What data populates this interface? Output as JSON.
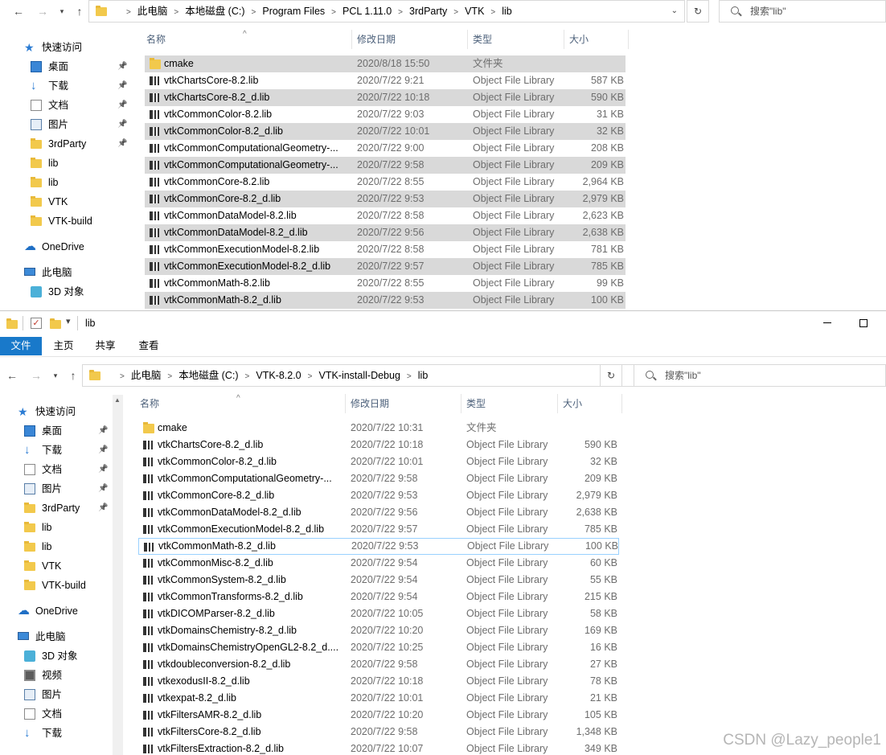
{
  "top_window": {
    "breadcrumbs": [
      "此电脑",
      "本地磁盘 (C:)",
      "Program Files",
      "PCL 1.11.0",
      "3rdParty",
      "VTK",
      "lib"
    ],
    "search_placeholder": "搜索\"lib\"",
    "columns": {
      "name": "名称",
      "date": "修改日期",
      "type": "类型",
      "size": "大小"
    },
    "nav": [
      {
        "label": "快速访问",
        "icon": "star-icon",
        "pinned": false,
        "indent": 1
      },
      {
        "label": "桌面",
        "icon": "desktop-icon",
        "pinned": true,
        "indent": 2
      },
      {
        "label": "下载",
        "icon": "download-icon",
        "pinned": true,
        "indent": 2
      },
      {
        "label": "文档",
        "icon": "document-icon",
        "pinned": true,
        "indent": 2
      },
      {
        "label": "图片",
        "icon": "pictures-icon",
        "pinned": true,
        "indent": 2
      },
      {
        "label": "3rdParty",
        "icon": "folder-icon",
        "pinned": true,
        "indent": 2
      },
      {
        "label": "lib",
        "icon": "folder-icon",
        "pinned": false,
        "indent": 2
      },
      {
        "label": "lib",
        "icon": "folder-icon",
        "pinned": false,
        "indent": 2
      },
      {
        "label": "VTK",
        "icon": "folder-icon",
        "pinned": false,
        "indent": 2
      },
      {
        "label": "VTK-build",
        "icon": "folder-icon",
        "pinned": false,
        "indent": 2
      },
      {
        "label": "OneDrive",
        "icon": "cloud-icon",
        "pinned": false,
        "indent": 1
      },
      {
        "label": "此电脑",
        "icon": "computer-icon",
        "pinned": false,
        "indent": 1
      },
      {
        "label": "3D 对象",
        "icon": "3d-objects-icon",
        "pinned": false,
        "indent": 2
      }
    ],
    "files": [
      {
        "name": "cmake",
        "date": "2020/8/18 15:50",
        "type": "文件夹",
        "size": "",
        "kind": "folder",
        "selected": true
      },
      {
        "name": "vtkChartsCore-8.2.lib",
        "date": "2020/7/22 9:21",
        "type": "Object File Library",
        "size": "587 KB",
        "kind": "lib",
        "selected": false
      },
      {
        "name": "vtkChartsCore-8.2_d.lib",
        "date": "2020/7/22 10:18",
        "type": "Object File Library",
        "size": "590 KB",
        "kind": "lib",
        "selected": true
      },
      {
        "name": "vtkCommonColor-8.2.lib",
        "date": "2020/7/22 9:03",
        "type": "Object File Library",
        "size": "31 KB",
        "kind": "lib",
        "selected": false
      },
      {
        "name": "vtkCommonColor-8.2_d.lib",
        "date": "2020/7/22 10:01",
        "type": "Object File Library",
        "size": "32 KB",
        "kind": "lib",
        "selected": true
      },
      {
        "name": "vtkCommonComputationalGeometry-...",
        "date": "2020/7/22 9:00",
        "type": "Object File Library",
        "size": "208 KB",
        "kind": "lib",
        "selected": false
      },
      {
        "name": "vtkCommonComputationalGeometry-...",
        "date": "2020/7/22 9:58",
        "type": "Object File Library",
        "size": "209 KB",
        "kind": "lib",
        "selected": true
      },
      {
        "name": "vtkCommonCore-8.2.lib",
        "date": "2020/7/22 8:55",
        "type": "Object File Library",
        "size": "2,964 KB",
        "kind": "lib",
        "selected": false
      },
      {
        "name": "vtkCommonCore-8.2_d.lib",
        "date": "2020/7/22 9:53",
        "type": "Object File Library",
        "size": "2,979 KB",
        "kind": "lib",
        "selected": true
      },
      {
        "name": "vtkCommonDataModel-8.2.lib",
        "date": "2020/7/22 8:58",
        "type": "Object File Library",
        "size": "2,623 KB",
        "kind": "lib",
        "selected": false
      },
      {
        "name": "vtkCommonDataModel-8.2_d.lib",
        "date": "2020/7/22 9:56",
        "type": "Object File Library",
        "size": "2,638 KB",
        "kind": "lib",
        "selected": true
      },
      {
        "name": "vtkCommonExecutionModel-8.2.lib",
        "date": "2020/7/22 8:58",
        "type": "Object File Library",
        "size": "781 KB",
        "kind": "lib",
        "selected": false
      },
      {
        "name": "vtkCommonExecutionModel-8.2_d.lib",
        "date": "2020/7/22 9:57",
        "type": "Object File Library",
        "size": "785 KB",
        "kind": "lib",
        "selected": true
      },
      {
        "name": "vtkCommonMath-8.2.lib",
        "date": "2020/7/22 8:55",
        "type": "Object File Library",
        "size": "99 KB",
        "kind": "lib",
        "selected": false
      },
      {
        "name": "vtkCommonMath-8.2_d.lib",
        "date": "2020/7/22 9:53",
        "type": "Object File Library",
        "size": "100 KB",
        "kind": "lib",
        "selected": true
      }
    ]
  },
  "bottom_window": {
    "title": "lib",
    "ribbon_tabs": [
      "文件",
      "主页",
      "共享",
      "查看"
    ],
    "breadcrumbs": [
      "此电脑",
      "本地磁盘 (C:)",
      "VTK-8.2.0",
      "VTK-install-Debug",
      "lib"
    ],
    "search_placeholder": "搜索\"lib\"",
    "columns": {
      "name": "名称",
      "date": "修改日期",
      "type": "类型",
      "size": "大小"
    },
    "nav": [
      {
        "label": "快速访问",
        "icon": "star-icon",
        "pinned": false,
        "indent": 1
      },
      {
        "label": "桌面",
        "icon": "desktop-icon",
        "pinned": true,
        "indent": 2
      },
      {
        "label": "下载",
        "icon": "download-icon",
        "pinned": true,
        "indent": 2
      },
      {
        "label": "文档",
        "icon": "document-icon",
        "pinned": true,
        "indent": 2
      },
      {
        "label": "图片",
        "icon": "pictures-icon",
        "pinned": true,
        "indent": 2
      },
      {
        "label": "3rdParty",
        "icon": "folder-icon",
        "pinned": true,
        "indent": 2
      },
      {
        "label": "lib",
        "icon": "folder-icon",
        "pinned": false,
        "indent": 2
      },
      {
        "label": "lib",
        "icon": "folder-icon",
        "pinned": false,
        "indent": 2
      },
      {
        "label": "VTK",
        "icon": "folder-icon",
        "pinned": false,
        "indent": 2
      },
      {
        "label": "VTK-build",
        "icon": "folder-icon",
        "pinned": false,
        "indent": 2
      },
      {
        "label": "OneDrive",
        "icon": "cloud-icon",
        "pinned": false,
        "indent": 1
      },
      {
        "label": "此电脑",
        "icon": "computer-icon",
        "pinned": false,
        "indent": 1
      },
      {
        "label": "3D 对象",
        "icon": "3d-objects-icon",
        "pinned": false,
        "indent": 2
      },
      {
        "label": "视频",
        "icon": "video-icon",
        "pinned": false,
        "indent": 2
      },
      {
        "label": "图片",
        "icon": "pictures-icon",
        "pinned": false,
        "indent": 2
      },
      {
        "label": "文档",
        "icon": "document-icon",
        "pinned": false,
        "indent": 2
      },
      {
        "label": "下载",
        "icon": "download-icon",
        "pinned": false,
        "indent": 2
      }
    ],
    "files": [
      {
        "name": "cmake",
        "date": "2020/7/22 10:31",
        "type": "文件夹",
        "size": "",
        "kind": "folder"
      },
      {
        "name": "vtkChartsCore-8.2_d.lib",
        "date": "2020/7/22 10:18",
        "type": "Object File Library",
        "size": "590 KB",
        "kind": "lib"
      },
      {
        "name": "vtkCommonColor-8.2_d.lib",
        "date": "2020/7/22 10:01",
        "type": "Object File Library",
        "size": "32 KB",
        "kind": "lib"
      },
      {
        "name": "vtkCommonComputationalGeometry-...",
        "date": "2020/7/22 9:58",
        "type": "Object File Library",
        "size": "209 KB",
        "kind": "lib"
      },
      {
        "name": "vtkCommonCore-8.2_d.lib",
        "date": "2020/7/22 9:53",
        "type": "Object File Library",
        "size": "2,979 KB",
        "kind": "lib"
      },
      {
        "name": "vtkCommonDataModel-8.2_d.lib",
        "date": "2020/7/22 9:56",
        "type": "Object File Library",
        "size": "2,638 KB",
        "kind": "lib"
      },
      {
        "name": "vtkCommonExecutionModel-8.2_d.lib",
        "date": "2020/7/22 9:57",
        "type": "Object File Library",
        "size": "785 KB",
        "kind": "lib"
      },
      {
        "name": "vtkCommonMath-8.2_d.lib",
        "date": "2020/7/22 9:53",
        "type": "Object File Library",
        "size": "100 KB",
        "kind": "lib",
        "focused": true
      },
      {
        "name": "vtkCommonMisc-8.2_d.lib",
        "date": "2020/7/22 9:54",
        "type": "Object File Library",
        "size": "60 KB",
        "kind": "lib"
      },
      {
        "name": "vtkCommonSystem-8.2_d.lib",
        "date": "2020/7/22 9:54",
        "type": "Object File Library",
        "size": "55 KB",
        "kind": "lib"
      },
      {
        "name": "vtkCommonTransforms-8.2_d.lib",
        "date": "2020/7/22 9:54",
        "type": "Object File Library",
        "size": "215 KB",
        "kind": "lib"
      },
      {
        "name": "vtkDICOMParser-8.2_d.lib",
        "date": "2020/7/22 10:05",
        "type": "Object File Library",
        "size": "58 KB",
        "kind": "lib"
      },
      {
        "name": "vtkDomainsChemistry-8.2_d.lib",
        "date": "2020/7/22 10:20",
        "type": "Object File Library",
        "size": "169 KB",
        "kind": "lib"
      },
      {
        "name": "vtkDomainsChemistryOpenGL2-8.2_d....",
        "date": "2020/7/22 10:25",
        "type": "Object File Library",
        "size": "16 KB",
        "kind": "lib"
      },
      {
        "name": "vtkdoubleconversion-8.2_d.lib",
        "date": "2020/7/22 9:58",
        "type": "Object File Library",
        "size": "27 KB",
        "kind": "lib"
      },
      {
        "name": "vtkexodusII-8.2_d.lib",
        "date": "2020/7/22 10:18",
        "type": "Object File Library",
        "size": "78 KB",
        "kind": "lib"
      },
      {
        "name": "vtkexpat-8.2_d.lib",
        "date": "2020/7/22 10:01",
        "type": "Object File Library",
        "size": "21 KB",
        "kind": "lib"
      },
      {
        "name": "vtkFiltersAMR-8.2_d.lib",
        "date": "2020/7/22 10:20",
        "type": "Object File Library",
        "size": "105 KB",
        "kind": "lib"
      },
      {
        "name": "vtkFiltersCore-8.2_d.lib",
        "date": "2020/7/22 9:58",
        "type": "Object File Library",
        "size": "1,348 KB",
        "kind": "lib"
      },
      {
        "name": "vtkFiltersExtraction-8.2_d.lib",
        "date": "2020/7/22 10:07",
        "type": "Object File Library",
        "size": "349 KB",
        "kind": "lib"
      }
    ]
  },
  "watermark": "CSDN @Lazy_people1",
  "colors": {
    "selected_row": "#d9d9d9",
    "focus_border": "#99d1ff",
    "ribbon_file_tab": "#1979ca",
    "folder": "#f2c94c"
  }
}
